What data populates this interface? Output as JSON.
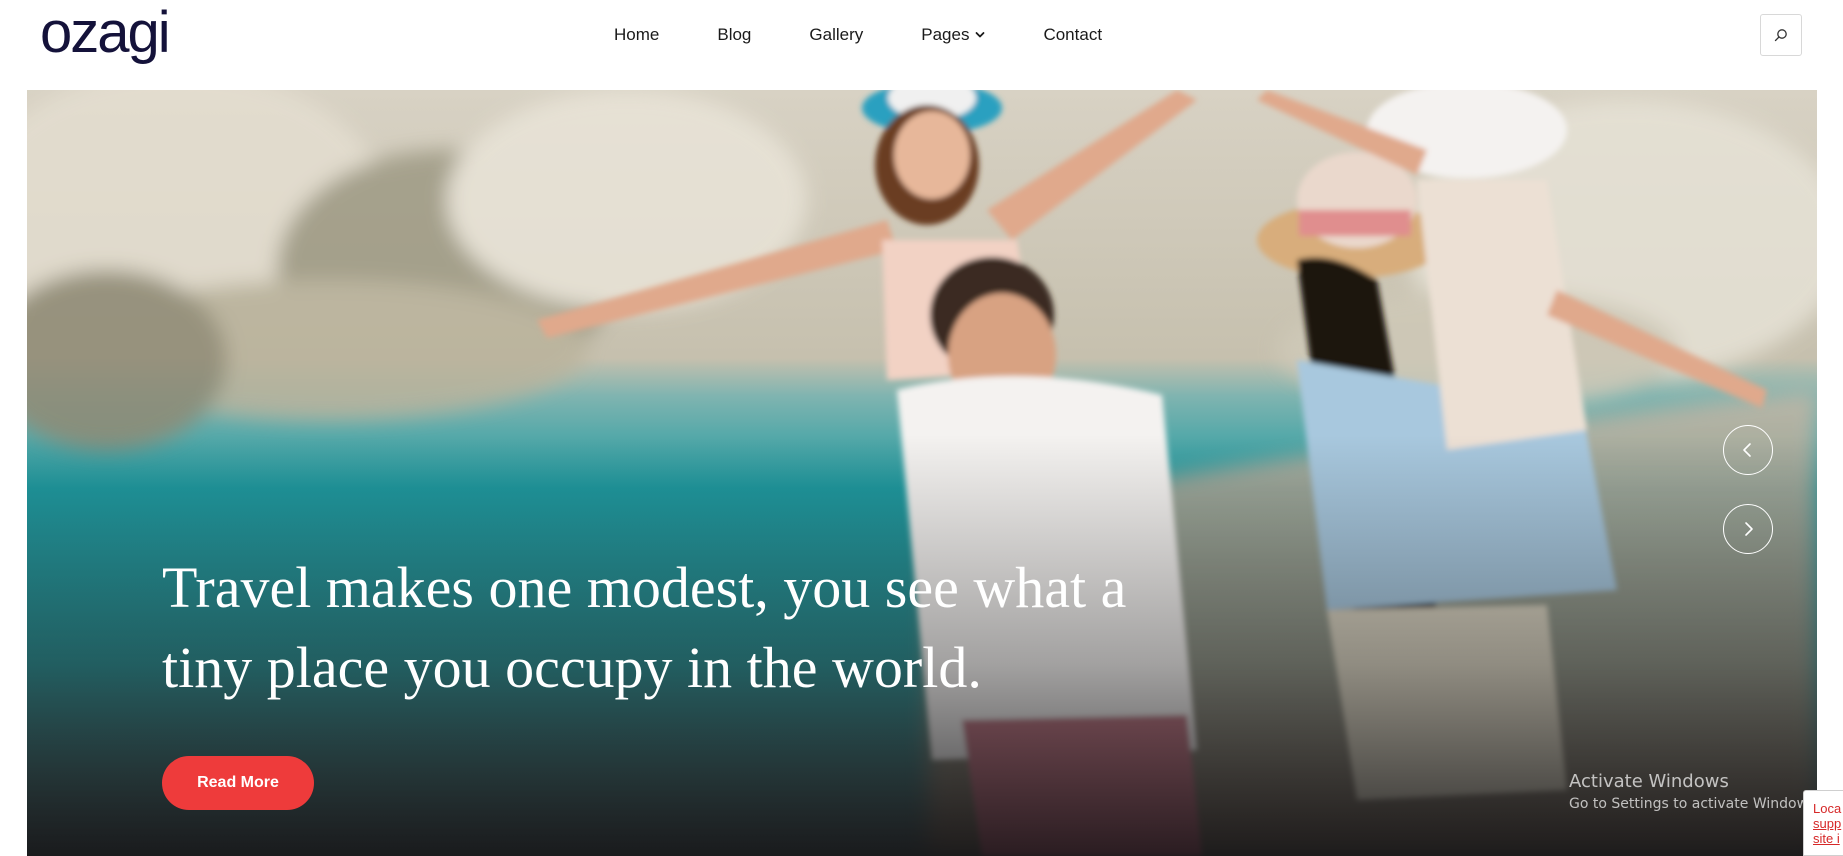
{
  "brand": {
    "logo_text": "ozagi",
    "logo_color": "#14123a"
  },
  "nav": {
    "items": [
      {
        "label": "Home"
      },
      {
        "label": "Blog"
      },
      {
        "label": "Gallery"
      },
      {
        "label": "Pages",
        "has_dropdown": true
      },
      {
        "label": "Contact"
      }
    ],
    "search_icon": "search-icon"
  },
  "hero": {
    "title": "Travel makes one modest, you see what a tiny place you occupy in the world.",
    "cta_label": "Read More",
    "cta_color": "#ee3b3b",
    "prev_icon": "chevron-left-icon",
    "next_icon": "chevron-right-icon"
  },
  "watermark": {
    "title": "Activate Windows",
    "subtitle": "Go to Settings to activate Windows."
  },
  "notice": {
    "line1": "Loca",
    "line2": "supp",
    "line3": "site i"
  }
}
